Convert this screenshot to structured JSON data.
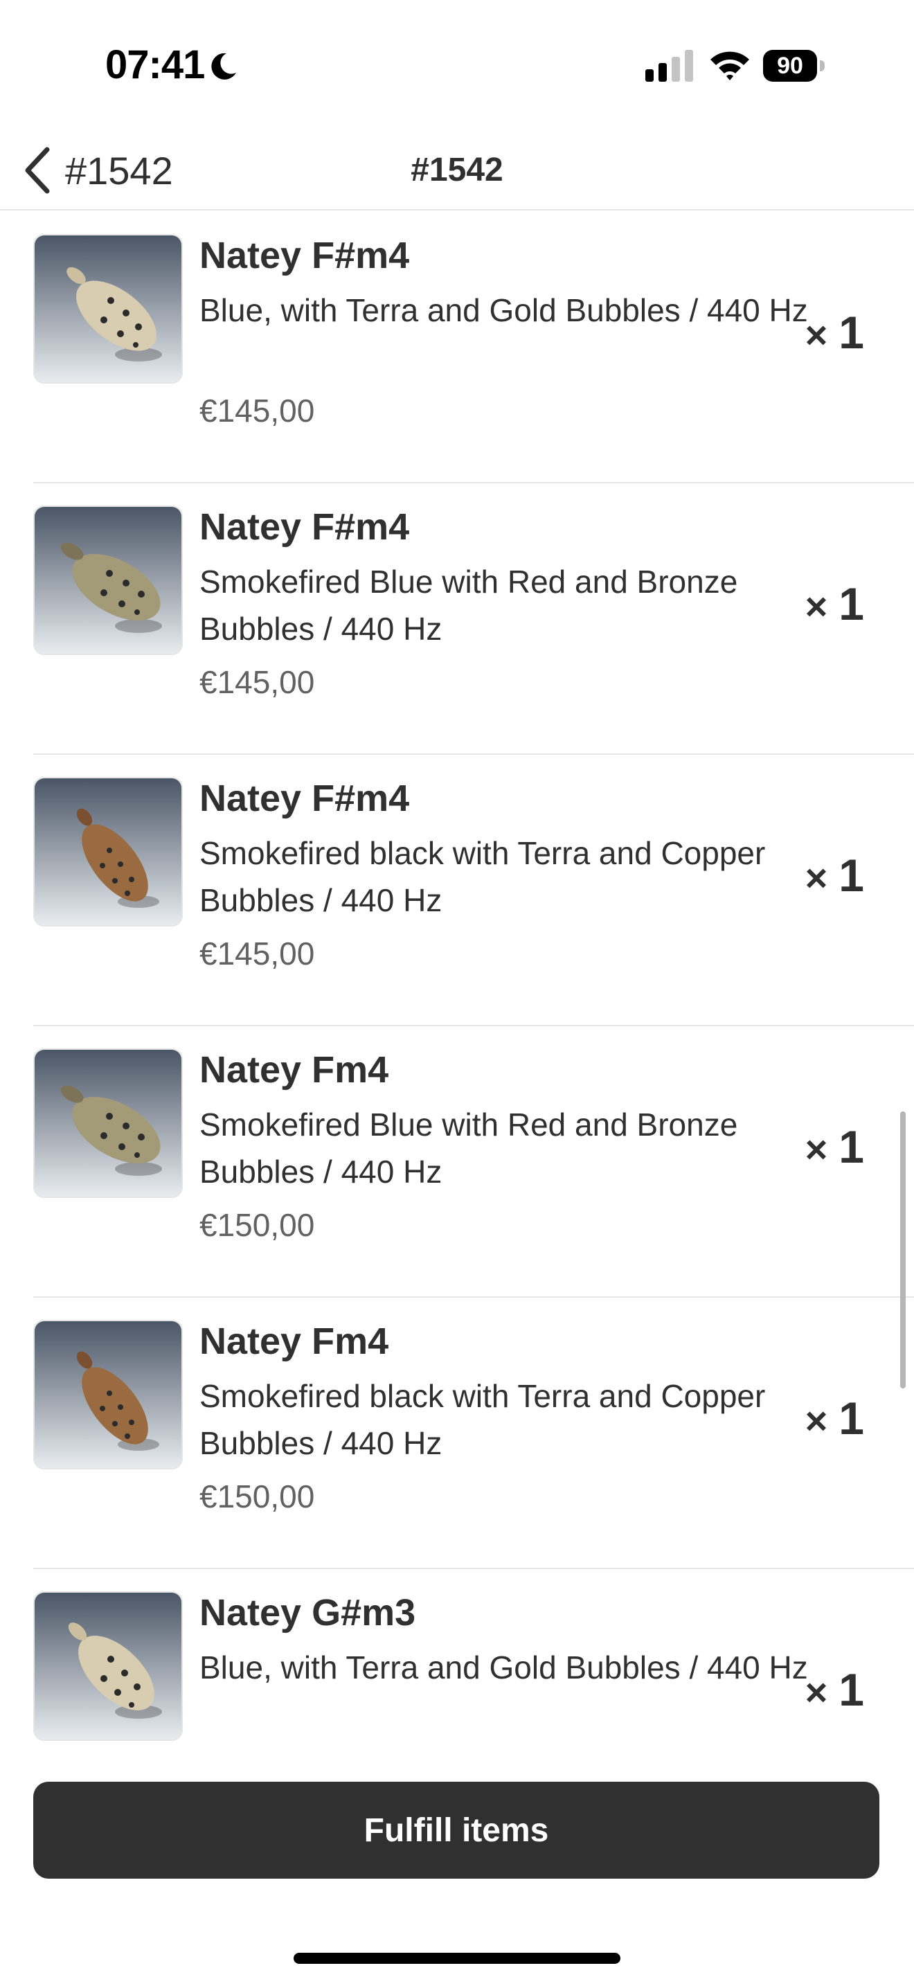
{
  "status_bar": {
    "time": "07:41",
    "battery": "90"
  },
  "header": {
    "back_label": "#1542",
    "title": "#1542"
  },
  "items": [
    {
      "name": "Natey F#m4",
      "variant": "Blue, with Terra and Gold Bubbles / 440 Hz",
      "price": "€145,00",
      "qty_prefix": "×",
      "qty": "1",
      "glaze": "light"
    },
    {
      "name": "Natey F#m4",
      "variant": "Smokefired Blue with Red and Bronze Bubbles / 440 Hz",
      "price": "€145,00",
      "qty_prefix": "×",
      "qty": "1",
      "glaze": "olive"
    },
    {
      "name": "Natey F#m4",
      "variant": "Smokefired black with Terra and Copper Bubbles / 440 Hz",
      "price": "€145,00",
      "qty_prefix": "×",
      "qty": "1",
      "glaze": "copper"
    },
    {
      "name": "Natey Fm4",
      "variant": "Smokefired Blue with Red and Bronze Bubbles / 440 Hz",
      "price": "€150,00",
      "qty_prefix": "×",
      "qty": "1",
      "glaze": "olive"
    },
    {
      "name": "Natey Fm4",
      "variant": "Smokefired black with Terra and Copper Bubbles / 440 Hz",
      "price": "€150,00",
      "qty_prefix": "×",
      "qty": "1",
      "glaze": "copper"
    },
    {
      "name": "Natey G#m3",
      "variant": "Blue, with Terra and Gold Bubbles / 440 Hz",
      "price": "",
      "qty_prefix": "×",
      "qty": "1",
      "glaze": "light"
    }
  ],
  "footer": {
    "fulfill_label": "Fulfill items"
  },
  "colors": {
    "primary_button": "#303030",
    "divider": "#e6e6e6",
    "muted_text": "#616161",
    "light_glaze": "#d8cdb0",
    "olive_glaze": "#a39a78",
    "copper_glaze": "#9a6a40"
  }
}
